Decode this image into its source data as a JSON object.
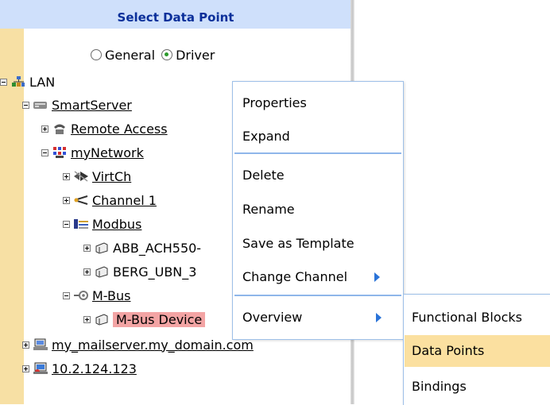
{
  "panel": {
    "title": "Select Data Point"
  },
  "filter": {
    "options": [
      "General",
      "Driver"
    ],
    "selected": "Driver"
  },
  "tree": {
    "lan": "LAN",
    "smartserver": "SmartServer",
    "remote_access": "Remote Access",
    "mynetwork": "myNetwork",
    "virtch": "VirtCh",
    "channel1": "Channel 1",
    "modbus": "Modbus",
    "abb": "ABB_ACH550-",
    "berg": "BERG_UBN_3",
    "mbus": "M-Bus",
    "mbus_device": "M-Bus Device",
    "mailserver": "my_mailserver.my_domain.com",
    "ip": "10.2.124.123"
  },
  "context_menu": {
    "properties": "Properties",
    "expand": "Expand",
    "delete": "Delete",
    "rename": "Rename",
    "save_template": "Save as Template",
    "change_channel": "Change Channel",
    "overview": "Overview"
  },
  "submenu": {
    "functional_blocks": "Functional Blocks",
    "data_points": "Data Points",
    "bindings": "Bindings"
  },
  "colors": {
    "header_bg": "#cfe0fb",
    "header_text": "#0a2f9a",
    "left_strip": "#f7e0a4",
    "selected_node": "#f3a4a4",
    "submenu_highlight": "#fbe0a0",
    "menu_separator": "#8fb6ea"
  },
  "icons": {
    "lan": "network-icon",
    "smartserver": "server-icon",
    "remote_access": "phone-icon",
    "mynetwork": "network-grid-icon",
    "virtch": "virtual-channel-icon",
    "channel1": "channel-icon",
    "modbus": "modbus-icon",
    "device": "device-icon",
    "mbus": "mbus-icon",
    "mailserver": "mail-server-icon",
    "ip": "computer-icon"
  }
}
